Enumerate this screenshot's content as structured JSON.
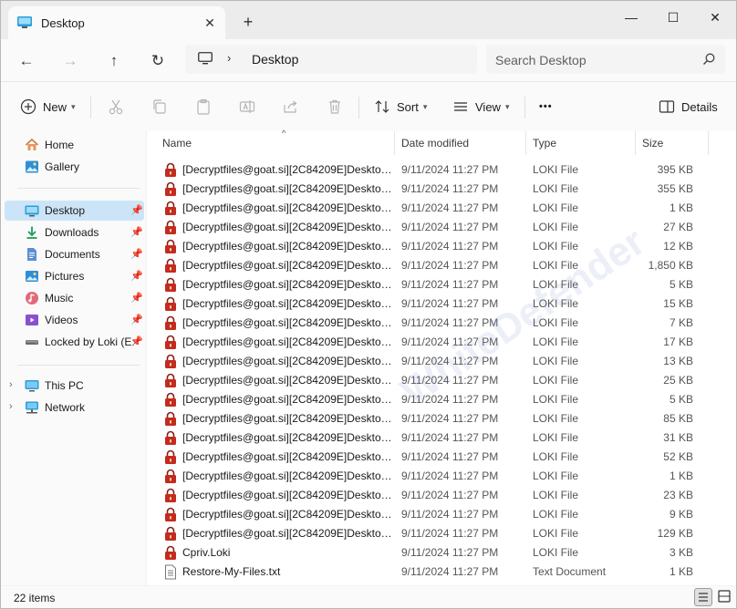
{
  "tab": {
    "title": "Desktop"
  },
  "window": {
    "minimize": "—",
    "maximize": "☐",
    "close": "✕"
  },
  "nav": {
    "back": "←",
    "forward": "→",
    "up": "↑",
    "refresh": "↻"
  },
  "address": {
    "separator": "›",
    "crumb": "Desktop"
  },
  "search": {
    "placeholder": "Search Desktop"
  },
  "commands": {
    "new": "New",
    "sort": "Sort",
    "view": "View",
    "more": "•••",
    "details": "Details"
  },
  "sidebar": {
    "items": [
      {
        "label": "Home",
        "icon": "home-icon"
      },
      {
        "label": "Gallery",
        "icon": "gallery-icon"
      },
      {
        "label": "Desktop",
        "icon": "desktop-icon"
      },
      {
        "label": "Downloads",
        "icon": "downloads-icon"
      },
      {
        "label": "Documents",
        "icon": "documents-icon"
      },
      {
        "label": "Pictures",
        "icon": "pictures-icon"
      },
      {
        "label": "Music",
        "icon": "music-icon"
      },
      {
        "label": "Videos",
        "icon": "videos-icon"
      },
      {
        "label": "Locked by Loki (E:",
        "icon": "drive-icon"
      },
      {
        "label": "This PC",
        "icon": "this-pc-icon"
      },
      {
        "label": "Network",
        "icon": "network-icon"
      }
    ]
  },
  "columns": {
    "name": "Name",
    "date": "Date modified",
    "type": "Type",
    "size": "Size"
  },
  "files": [
    {
      "name": "[Decryptfiles@goat.si][2C84209E]Desktop...",
      "date": "9/11/2024 11:27 PM",
      "type": "LOKI File",
      "size": "395 KB"
    },
    {
      "name": "[Decryptfiles@goat.si][2C84209E]Desktop...",
      "date": "9/11/2024 11:27 PM",
      "type": "LOKI File",
      "size": "355 KB"
    },
    {
      "name": "[Decryptfiles@goat.si][2C84209E]Desktop...",
      "date": "9/11/2024 11:27 PM",
      "type": "LOKI File",
      "size": "1 KB"
    },
    {
      "name": "[Decryptfiles@goat.si][2C84209E]Desktop...",
      "date": "9/11/2024 11:27 PM",
      "type": "LOKI File",
      "size": "27 KB"
    },
    {
      "name": "[Decryptfiles@goat.si][2C84209E]Desktop...",
      "date": "9/11/2024 11:27 PM",
      "type": "LOKI File",
      "size": "12 KB"
    },
    {
      "name": "[Decryptfiles@goat.si][2C84209E]Desktop...",
      "date": "9/11/2024 11:27 PM",
      "type": "LOKI File",
      "size": "1,850 KB"
    },
    {
      "name": "[Decryptfiles@goat.si][2C84209E]Desktop...",
      "date": "9/11/2024 11:27 PM",
      "type": "LOKI File",
      "size": "5 KB"
    },
    {
      "name": "[Decryptfiles@goat.si][2C84209E]Desktop...",
      "date": "9/11/2024 11:27 PM",
      "type": "LOKI File",
      "size": "15 KB"
    },
    {
      "name": "[Decryptfiles@goat.si][2C84209E]Desktop...",
      "date": "9/11/2024 11:27 PM",
      "type": "LOKI File",
      "size": "7 KB"
    },
    {
      "name": "[Decryptfiles@goat.si][2C84209E]Desktop...",
      "date": "9/11/2024 11:27 PM",
      "type": "LOKI File",
      "size": "17 KB"
    },
    {
      "name": "[Decryptfiles@goat.si][2C84209E]Desktop...",
      "date": "9/11/2024 11:27 PM",
      "type": "LOKI File",
      "size": "13 KB"
    },
    {
      "name": "[Decryptfiles@goat.si][2C84209E]Desktop...",
      "date": "9/11/2024 11:27 PM",
      "type": "LOKI File",
      "size": "25 KB"
    },
    {
      "name": "[Decryptfiles@goat.si][2C84209E]Desktop...",
      "date": "9/11/2024 11:27 PM",
      "type": "LOKI File",
      "size": "5 KB"
    },
    {
      "name": "[Decryptfiles@goat.si][2C84209E]Desktop...",
      "date": "9/11/2024 11:27 PM",
      "type": "LOKI File",
      "size": "85 KB"
    },
    {
      "name": "[Decryptfiles@goat.si][2C84209E]Desktop...",
      "date": "9/11/2024 11:27 PM",
      "type": "LOKI File",
      "size": "31 KB"
    },
    {
      "name": "[Decryptfiles@goat.si][2C84209E]Desktop...",
      "date": "9/11/2024 11:27 PM",
      "type": "LOKI File",
      "size": "52 KB"
    },
    {
      "name": "[Decryptfiles@goat.si][2C84209E]Desktop...",
      "date": "9/11/2024 11:27 PM",
      "type": "LOKI File",
      "size": "1 KB"
    },
    {
      "name": "[Decryptfiles@goat.si][2C84209E]Desktop...",
      "date": "9/11/2024 11:27 PM",
      "type": "LOKI File",
      "size": "23 KB"
    },
    {
      "name": "[Decryptfiles@goat.si][2C84209E]Desktop...",
      "date": "9/11/2024 11:27 PM",
      "type": "LOKI File",
      "size": "9 KB"
    },
    {
      "name": "[Decryptfiles@goat.si][2C84209E]Desktop...",
      "date": "9/11/2024 11:27 PM",
      "type": "LOKI File",
      "size": "129 KB"
    },
    {
      "name": "Cpriv.Loki",
      "date": "9/11/2024 11:27 PM",
      "type": "LOKI File",
      "size": "3 KB"
    },
    {
      "name": "Restore-My-Files.txt",
      "date": "9/11/2024 11:27 PM",
      "type": "Text Document",
      "size": "1 KB"
    }
  ],
  "status": {
    "count": "22 items"
  },
  "watermark": "WhiteDefender",
  "colors": {
    "selection": "#cce4f7",
    "lock": "#c42b1c",
    "accent": "#0067c0"
  }
}
